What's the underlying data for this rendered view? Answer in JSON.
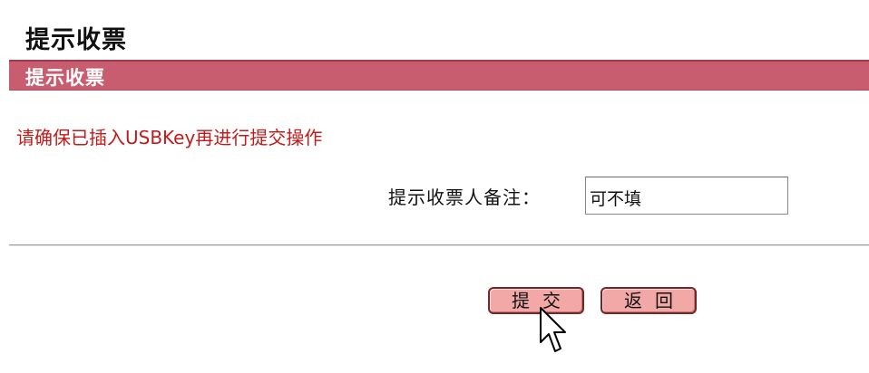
{
  "page": {
    "title": "提示收票"
  },
  "section": {
    "header": "提示收票"
  },
  "form": {
    "warning": "请确保已插入USBKey再进行提交操作",
    "remark_label": "提示收票人备注：",
    "remark_value": "可不填"
  },
  "actions": {
    "submit_label": "提交",
    "back_label": "返回"
  },
  "colors": {
    "header_bg": "#c85d70",
    "warning_text": "#c41a1a",
    "button_bg": "#f3a8a8"
  },
  "icons": {
    "cursor": "pointer-cursor-icon"
  }
}
